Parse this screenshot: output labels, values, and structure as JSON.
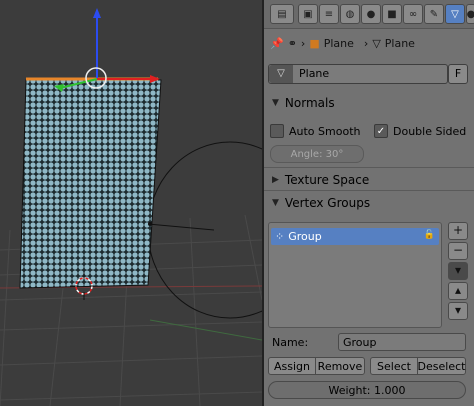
{
  "toolbar": {
    "icons": [
      "editor-type-icon",
      "render-icon",
      "render-layers-icon",
      "scene-icon",
      "world-icon",
      "object-icon",
      "constraints-icon",
      "modifiers-icon",
      "data-icon",
      "material-icon"
    ],
    "active": "data-icon"
  },
  "breadcrumb": {
    "object_name": "Plane",
    "mesh_name": "Plane"
  },
  "datablock": {
    "name": "Plane",
    "fake_user_label": "F"
  },
  "normals": {
    "title": "Normals",
    "auto_smooth_label": "Auto Smooth",
    "auto_smooth_checked": false,
    "double_sided_label": "Double Sided",
    "double_sided_checked": true,
    "angle_label": "Angle: 30°"
  },
  "texture_space": {
    "title": "Texture Space"
  },
  "vertex_groups": {
    "title": "Vertex Groups",
    "items": [
      {
        "name": "Group",
        "selected": true
      }
    ],
    "name_label": "Name:",
    "name_value": "Group",
    "assign_label": "Assign",
    "remove_label": "Remove",
    "select_label": "Select",
    "deselect_label": "Deselect",
    "weight_label": "Weight: 1.000"
  },
  "colors": {
    "viewport_bg": "#3c3c3c",
    "mesh_fill": "#8fb8c6",
    "selected_blue": "#5680c2",
    "panel_bg": "#727272"
  }
}
